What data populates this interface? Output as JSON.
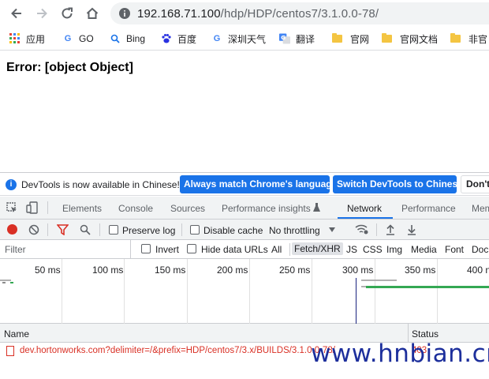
{
  "browser": {
    "url_host": "192.168.71.100",
    "url_path": "/hdp/HDP/centos7/3.1.0.0-78/",
    "bookmarks": [
      "应用",
      "GO",
      "Bing",
      "百度",
      "深圳天气",
      "翻译",
      "官网",
      "官网文档",
      "非官"
    ]
  },
  "page": {
    "error_text": "Error: [object Object]"
  },
  "devtools": {
    "infobar": {
      "message": "DevTools is now available in Chinese!",
      "btn_match": "Always match Chrome's language",
      "btn_switch": "Switch DevTools to Chinese",
      "btn_dont": "Don't"
    },
    "tabs": [
      "Elements",
      "Console",
      "Sources",
      "Performance insights",
      "Network",
      "Performance",
      "Mem"
    ],
    "active_tab": "Network",
    "toolbar": {
      "preserve_log": "Preserve log",
      "disable_cache": "Disable cache",
      "throttling": "No throttling"
    },
    "filter": {
      "placeholder": "Filter",
      "invert": "Invert",
      "hide_data_urls": "Hide data URLs",
      "types": [
        "All",
        "Fetch/XHR",
        "JS",
        "CSS",
        "Img",
        "Media",
        "Font",
        "Doc"
      ],
      "selected_type": "Fetch/XHR"
    },
    "timeline": {
      "labels": [
        "50 ms",
        "100 ms",
        "150 ms",
        "200 ms",
        "250 ms",
        "300 ms",
        "350 ms",
        "400 n"
      ]
    },
    "table": {
      "columns": [
        "Name",
        "Status"
      ],
      "rows": [
        {
          "name": "dev.hortonworks.com?delimiter=/&prefix=HDP/centos7/3.x/BUILDS/3.1.0.0-78/",
          "status": "403"
        }
      ]
    }
  },
  "watermark": "www.hnbian.cn",
  "colors": {
    "accent": "#1a73e8",
    "error": "#d93025",
    "record": "#d93025",
    "waterfall_green": "#34a853",
    "watermark": "#1d2f9c"
  }
}
